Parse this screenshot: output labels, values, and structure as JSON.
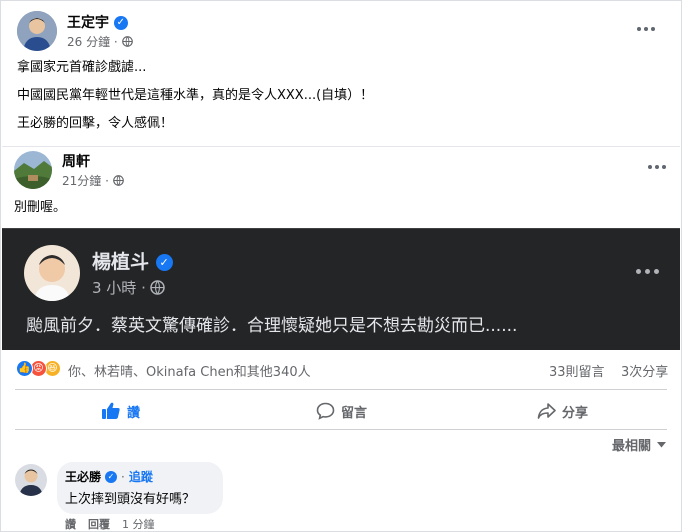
{
  "post": {
    "author": "王定宇",
    "time": "26 分鐘 ·",
    "lines": [
      "拿國家元首確診戲謔...",
      "中國國民黨年輕世代是這種水準，真的是令人XXX...(自填）！",
      "王必勝的回擊，令人感佩！"
    ]
  },
  "shared_light": {
    "author": "周軒",
    "time": "21分鐘 ·",
    "text": "別刪喔。"
  },
  "shared_dark": {
    "author": "楊植斗",
    "time": "3 小時 ·",
    "text": "颱風前夕．蔡英文驚傳確診．合理懷疑她只是不想去勘災而已......"
  },
  "reactions": {
    "summary": "你、林若晴、Okinafa Chen和其他340人",
    "comments": "33則留言",
    "shares": "3次分享"
  },
  "actions": {
    "like": "讚",
    "comment": "留言",
    "share": "分享"
  },
  "sort": {
    "label": "最相關"
  },
  "comment": {
    "author": "王必勝",
    "follow": "追蹤",
    "text": "上次摔到頭沒有好嗎？",
    "like": "讚",
    "reply": "回覆",
    "time": "1 分鐘"
  },
  "colors": {
    "accent": "#1877f2",
    "muted": "#65676b",
    "dark_bg": "#242526"
  }
}
